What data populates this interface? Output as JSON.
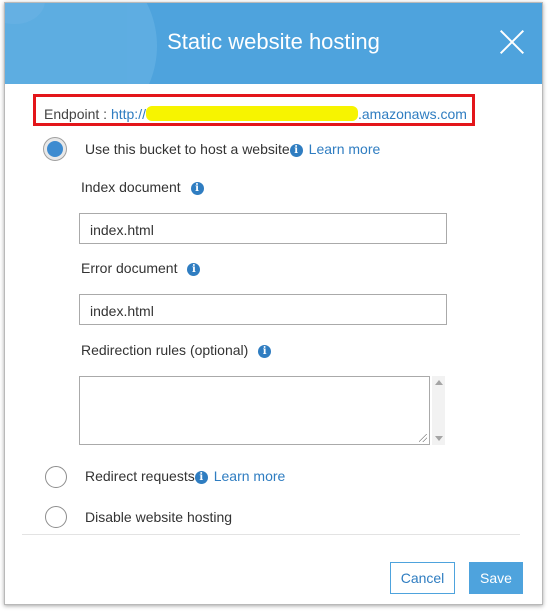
{
  "dialog": {
    "title": "Static website hosting",
    "close_icon": "close-icon",
    "header_color": "#4ea3dd"
  },
  "endpoint": {
    "label": "Endpoint :",
    "url_prefix": "http://",
    "url_suffix": ".amazonaws.com",
    "highlight_color": "#e3151a"
  },
  "options": {
    "host": {
      "label": "Use this bucket to host a website",
      "learn_more": "Learn more",
      "selected": true
    },
    "redirect": {
      "label": "Redirect requests",
      "learn_more": "Learn more",
      "selected": false
    },
    "disable": {
      "label": "Disable website hosting",
      "selected": false
    }
  },
  "fields": {
    "index_label": "Index document",
    "index_value": "index.html",
    "error_label": "Error document",
    "error_value": "index.html",
    "redirection_label": "Redirection rules (optional)",
    "redirection_value": ""
  },
  "info_glyph": "i",
  "buttons": {
    "cancel": "Cancel",
    "save": "Save"
  },
  "accent_color": "#2f7dc1"
}
